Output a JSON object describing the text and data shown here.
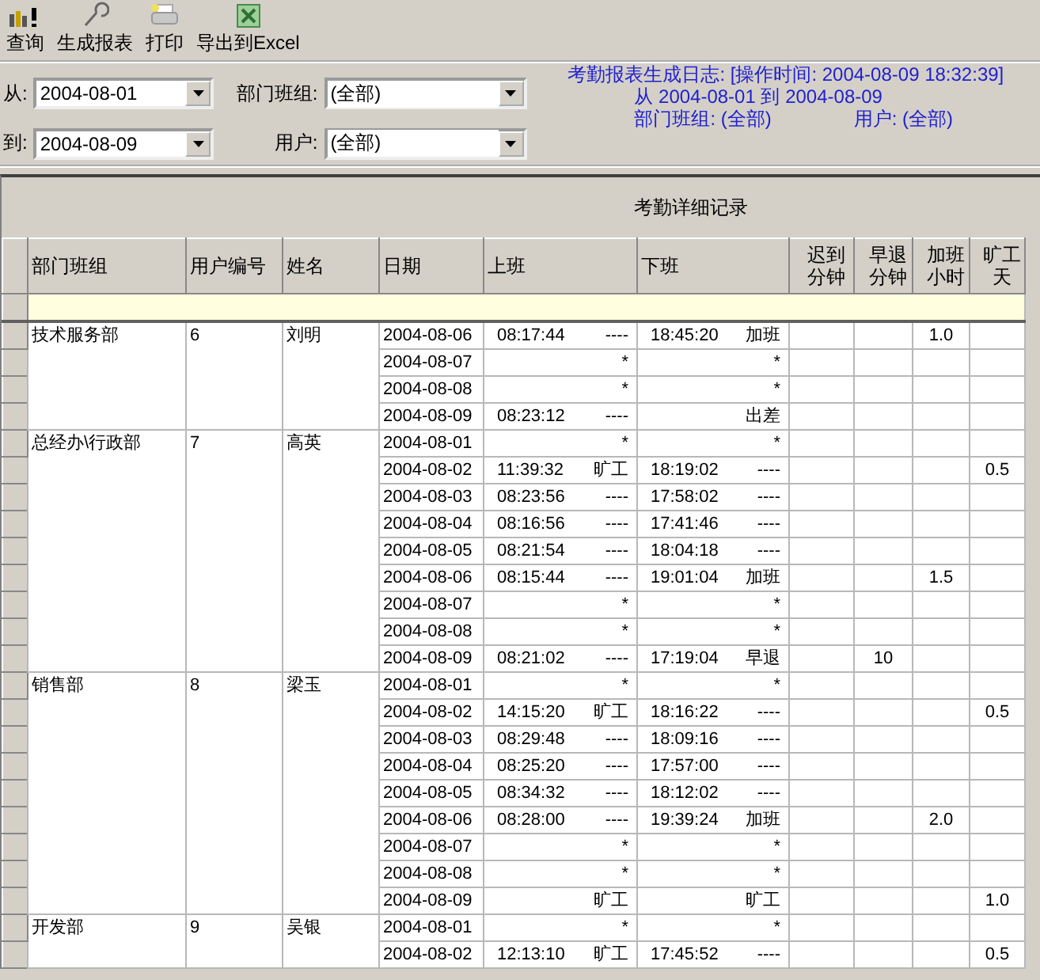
{
  "toolbar": [
    {
      "kind": "query",
      "label": "查询"
    },
    {
      "kind": "report",
      "label": "生成报表"
    },
    {
      "kind": "print",
      "label": "打印"
    },
    {
      "kind": "excel",
      "label": "导出到Excel"
    }
  ],
  "filters": {
    "from": {
      "label": "从:",
      "value": "2004-08-01"
    },
    "to": {
      "label": "到:",
      "value": "2004-08-09"
    },
    "department": {
      "label": "部门班组:",
      "value": "(全部)"
    },
    "user": {
      "label": "用户:",
      "value": "(全部)"
    }
  },
  "log": {
    "line1": "考勤报表生成日志: [操作时间: 2004-08-09 18:32:39]",
    "line2": "从 2004-08-01 到 2004-08-09",
    "department": "部门班组: (全部)",
    "user": "用户: (全部)"
  },
  "table": {
    "title": "考勤详细记录",
    "columns": [
      "部门班组",
      "用户编号",
      "姓名",
      "日期",
      "上班",
      "下班",
      "迟到分钟",
      "早退分钟",
      "加班小时",
      "旷工天"
    ],
    "groups": [
      {
        "department": "技术服务部",
        "user_id": "6",
        "name": "刘明",
        "records": [
          {
            "date": "2004-08-06",
            "in_time": "08:17:44",
            "in_mark": "----",
            "out_time": "18:45:20",
            "out_mark": "加班",
            "overtime": "1.0"
          },
          {
            "date": "2004-08-07",
            "in_mark": "*",
            "out_mark": "*"
          },
          {
            "date": "2004-08-08",
            "in_mark": "*",
            "out_mark": "*"
          },
          {
            "date": "2004-08-09",
            "in_time": "08:23:12",
            "in_mark": "----",
            "out_mark": "出差"
          }
        ]
      },
      {
        "department": "总经办\\行政部",
        "user_id": "7",
        "name": "高英",
        "records": [
          {
            "date": "2004-08-01",
            "in_mark": "*",
            "out_mark": "*"
          },
          {
            "date": "2004-08-02",
            "in_time": "11:39:32",
            "in_mark": "旷工",
            "out_time": "18:19:02",
            "out_mark": "----",
            "absent": "0.5"
          },
          {
            "date": "2004-08-03",
            "in_time": "08:23:56",
            "in_mark": "----",
            "out_time": "17:58:02",
            "out_mark": "----"
          },
          {
            "date": "2004-08-04",
            "in_time": "08:16:56",
            "in_mark": "----",
            "out_time": "17:41:46",
            "out_mark": "----"
          },
          {
            "date": "2004-08-05",
            "in_time": "08:21:54",
            "in_mark": "----",
            "out_time": "18:04:18",
            "out_mark": "----"
          },
          {
            "date": "2004-08-06",
            "in_time": "08:15:44",
            "in_mark": "----",
            "out_time": "19:01:04",
            "out_mark": "加班",
            "overtime": "1.5"
          },
          {
            "date": "2004-08-07",
            "in_mark": "*",
            "out_mark": "*"
          },
          {
            "date": "2004-08-08",
            "in_mark": "*",
            "out_mark": "*"
          },
          {
            "date": "2004-08-09",
            "in_time": "08:21:02",
            "in_mark": "----",
            "out_time": "17:19:04",
            "out_mark": "早退",
            "early": "10"
          }
        ]
      },
      {
        "department": "销售部",
        "user_id": "8",
        "name": "梁玉",
        "records": [
          {
            "date": "2004-08-01",
            "in_mark": "*",
            "out_mark": "*"
          },
          {
            "date": "2004-08-02",
            "in_time": "14:15:20",
            "in_mark": "旷工",
            "out_time": "18:16:22",
            "out_mark": "----",
            "absent": "0.5"
          },
          {
            "date": "2004-08-03",
            "in_time": "08:29:48",
            "in_mark": "----",
            "out_time": "18:09:16",
            "out_mark": "----"
          },
          {
            "date": "2004-08-04",
            "in_time": "08:25:20",
            "in_mark": "----",
            "out_time": "17:57:00",
            "out_mark": "----"
          },
          {
            "date": "2004-08-05",
            "in_time": "08:34:32",
            "in_mark": "----",
            "out_time": "18:12:02",
            "out_mark": "----"
          },
          {
            "date": "2004-08-06",
            "in_time": "08:28:00",
            "in_mark": "----",
            "out_time": "19:39:24",
            "out_mark": "加班",
            "overtime": "2.0"
          },
          {
            "date": "2004-08-07",
            "in_mark": "*",
            "out_mark": "*"
          },
          {
            "date": "2004-08-08",
            "in_mark": "*",
            "out_mark": "*"
          },
          {
            "date": "2004-08-09",
            "in_mark": "旷工",
            "out_mark": "旷工",
            "absent": "1.0"
          }
        ]
      },
      {
        "department": "开发部",
        "user_id": "9",
        "name": "吴银",
        "records": [
          {
            "date": "2004-08-01",
            "in_mark": "*",
            "out_mark": "*"
          },
          {
            "date": "2004-08-02",
            "in_time": "12:13:10",
            "in_mark": "旷工",
            "out_time": "17:45:52",
            "out_mark": "----",
            "absent": "0.5"
          }
        ]
      }
    ]
  }
}
